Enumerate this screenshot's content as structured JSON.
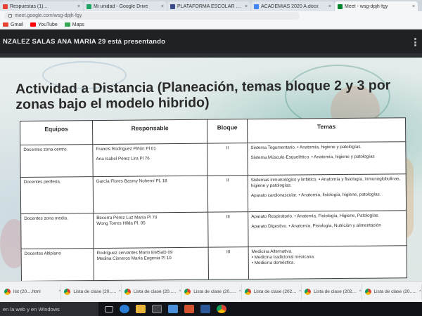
{
  "browser": {
    "tabs": [
      {
        "title": "Respuestas (1)...",
        "icon_color": "#ea4335",
        "active": false
      },
      {
        "title": "Mi unidad - Google Drive",
        "icon_color": "#1fa463",
        "active": false
      },
      {
        "title": "PLATAFORMA ESCOLAR COBACH",
        "icon_color": "#3b4b8c",
        "active": false
      },
      {
        "title": "ACADEMIAS 2020 A.docx",
        "icon_color": "#4285f4",
        "active": false
      },
      {
        "title": "Meet - wsg-dpjh-fgy",
        "icon_color": "#00832d",
        "active": true
      }
    ],
    "tab_close_glyph": "×",
    "url": "meet.google.com/wsg-dpjh-fgy",
    "bookmarks": [
      {
        "label": "Gmail",
        "icon_color": "#ea4335"
      },
      {
        "label": "YouTube",
        "icon_color": "#ff0000"
      },
      {
        "label": "Maps",
        "icon_color": "#34a853"
      }
    ]
  },
  "meet": {
    "presenter_text": "NZALEZ SALAS ANA MARIA 29 está presentando"
  },
  "slide": {
    "title": "Actividad a Distancia (Planeación, temas bloque 2 y 3 por zonas bajo el modelo hibrido)",
    "table": {
      "headers": [
        "Equipos",
        "Responsable",
        "Bloque",
        "Temas"
      ],
      "rows": [
        {
          "equipo": "Docentes zona centro.",
          "responsables": [
            "Francis Rodríguez Piñón  Pl 01",
            "Ana Isabel  Pérez Lira  Pl 76"
          ],
          "bloque": "II",
          "temas": [
            "Sistema Tegumentario.  • Anatomía, higiene y patologías.",
            "Sistema Músculo-Esquelético.  • Anatomía, higiene y patologías"
          ]
        },
        {
          "equipo": "Docentes  periferia.",
          "responsables": [
            "García Flores Basmy Nohemí PL 18"
          ],
          "bloque": "II",
          "temas": [
            "Sistemas inmunológico y linfático.  • Anatomía y fisiología, inmunoglobulinas, higiene y patologías.",
            "Aparato cardiovascular.  • Anatomía, fisiología, higiene, patologías."
          ]
        },
        {
          "equipo": "Docentes zona media.",
          "responsables": [
            "Becerra Pérez Luz María Pl 70",
            "Wong Torres Hilda Pl. 05"
          ],
          "bloque": "III",
          "temas": [
            "Aparato Respiratorio.  • Anatomía, Fisiología, Higiene, Patologías.",
            "Aparato Digestivo.  • Anatomía, Fisiología, Nutrición y alimentación"
          ]
        },
        {
          "equipo": "Docentes Altiplano",
          "responsables": [
            "Rodríguez cervantes Mario EMSaD 09",
            "Medina Cisneros  María Eugenia  Pl 10"
          ],
          "bloque": "III",
          "temas": [
            "Medicina Alternativa.",
            "• Medicina tradicional mexicana.",
            "• Medicina doméstica."
          ]
        }
      ]
    }
  },
  "downloads": {
    "items": [
      {
        "name": "list (20....html"
      },
      {
        "name": "Lista de clase (20....html"
      },
      {
        "name": "Lista de clase (20....html"
      },
      {
        "name": "Lista de clase (20....html"
      },
      {
        "name": "Lista de clase (202....csv"
      },
      {
        "name": "Lista de clase (202....html"
      },
      {
        "name": "Lista de clase (20....html"
      }
    ],
    "chevron_glyph": "^"
  },
  "taskbar": {
    "search_text": "en la web y en Windows"
  }
}
